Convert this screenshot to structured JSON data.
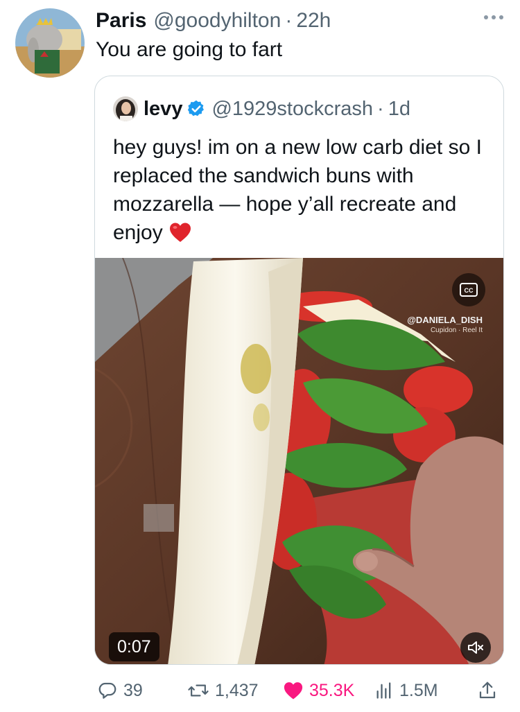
{
  "tweet": {
    "author_name": "Paris",
    "author_handle": "@goodyhilton",
    "separator": "·",
    "time": "22h",
    "text": "You are going to fart"
  },
  "quoted_tweet": {
    "author_name": "levy",
    "author_handle": "@1929stockcrash",
    "separator": "·",
    "time": "1d",
    "text": "hey guys! im on a new low carb diet so I replaced the sandwich buns with mozzarella — hope y’all recreate and enjoy",
    "emoji": "heart-emoji",
    "media": {
      "duration": "0:07",
      "watermark": "@DANIELA_DISH",
      "watermark_sub": "Cupidon · Reel It",
      "description_icons": [
        "cc-icon",
        "mute-icon"
      ]
    }
  },
  "actions": {
    "replies": "39",
    "retweets": "1,437",
    "likes": "35.3K",
    "views": "1.5M"
  },
  "colors": {
    "text": "#0f1419",
    "secondary": "#536471",
    "border": "#cfd9de",
    "like": "#f91880",
    "verified": "#1d9bf0"
  }
}
